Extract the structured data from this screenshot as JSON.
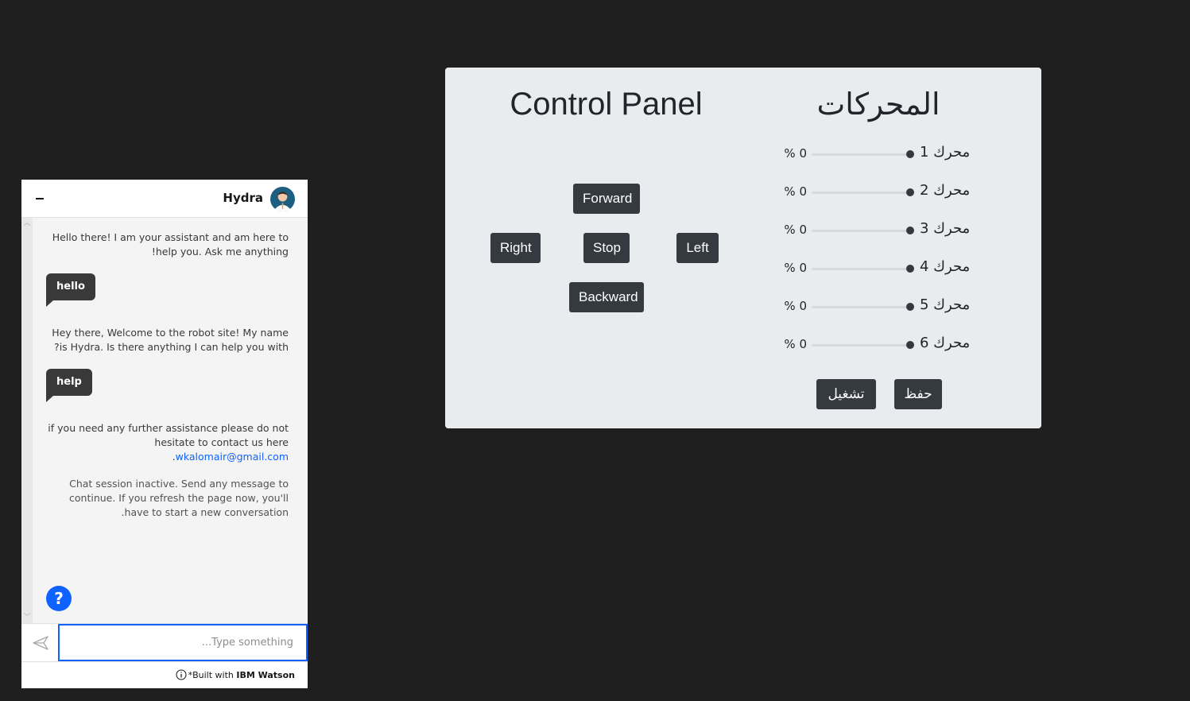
{
  "chat": {
    "bot_name": "Hydra",
    "messages": [
      {
        "from": "bot",
        "text": "Hello there! I am your assistant and am here to help you. Ask me anything!"
      },
      {
        "from": "user",
        "text": "hello"
      },
      {
        "from": "bot",
        "text": "Hey there, Welcome to the robot site! My name is Hydra. Is there anything I can help you with?"
      },
      {
        "from": "user",
        "text": "help"
      },
      {
        "from": "bot",
        "text_before_link": "if you need any further assistance please do not hesitate to contact us here",
        "link": "wkalomair@gmail.com",
        "text_after_link": "."
      },
      {
        "from": "system",
        "text": "Chat session inactive. Send any message to continue. If you refresh the page now, you'll have to start a new conversation."
      }
    ],
    "input": {
      "placeholder": "Type something...",
      "value": ""
    },
    "help_icon_label": "?",
    "footer": {
      "prefix": "*Built with",
      "brand": "IBM Watson"
    },
    "accent_color": "#0f62fe"
  },
  "panel": {
    "title": "Control Panel",
    "motors_title": "المحركات",
    "direction_buttons": {
      "forward": "Forward",
      "right": "Right",
      "stop": "Stop",
      "left": "Left",
      "backward": "Backward"
    },
    "motors": [
      {
        "label": "محرك 1",
        "percent": "0 %",
        "value": 0
      },
      {
        "label": "محرك 2",
        "percent": "0 %",
        "value": 0
      },
      {
        "label": "محرك 3",
        "percent": "0 %",
        "value": 0
      },
      {
        "label": "محرك 4",
        "percent": "0 %",
        "value": 0
      },
      {
        "label": "محرك 5",
        "percent": "0 %",
        "value": 0
      },
      {
        "label": "محرك 6",
        "percent": "0 %",
        "value": 0
      }
    ],
    "run_button": "تشغيل",
    "save_button": "حفظ",
    "button_color": "#343a40",
    "background_color": "#e9ecef"
  }
}
